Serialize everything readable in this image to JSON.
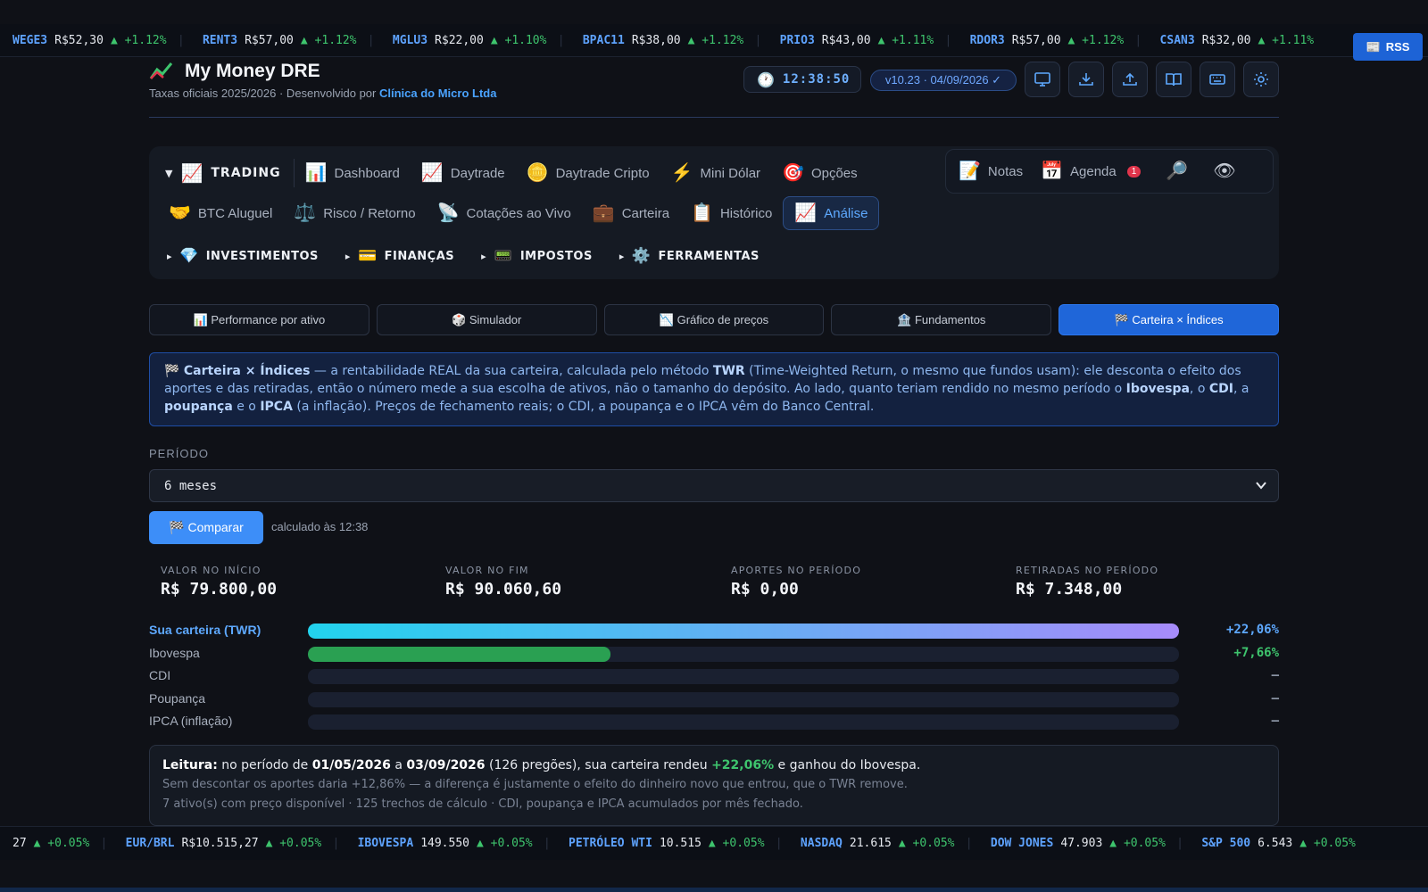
{
  "ticker_top": [
    {
      "symbol": "WEGE3",
      "price": "R$52,30",
      "change": "▲ +1.12%"
    },
    {
      "symbol": "RENT3",
      "price": "R$57,00",
      "change": "▲ +1.12%"
    },
    {
      "symbol": "MGLU3",
      "price": "R$22,00",
      "change": "▲ +1.10%"
    },
    {
      "symbol": "BPAC11",
      "price": "R$38,00",
      "change": "▲ +1.12%"
    },
    {
      "symbol": "PRIO3",
      "price": "R$43,00",
      "change": "▲ +1.11%"
    },
    {
      "symbol": "RDOR3",
      "price": "R$57,00",
      "change": "▲ +1.12%"
    },
    {
      "symbol": "CSAN3",
      "price": "R$32,00",
      "change": "▲ +1.11%"
    }
  ],
  "rss": {
    "label": "RSS",
    "icon": "newspaper-icon"
  },
  "header": {
    "title": "My Money DRE",
    "subtitle_prefix": "Taxas oficiais 2025/2026 · Desenvolvido por ",
    "subtitle_brand": "Clínica do Micro Ltda",
    "clock": "12:38:50",
    "version": "v10.23 · 04/09/2026 ✓",
    "icons": [
      "monitor-icon",
      "download-icon",
      "upload-icon",
      "book-icon",
      "keyboard-icon",
      "settings-icon"
    ]
  },
  "nav": {
    "group_trading": {
      "label": "TRADING",
      "icon": "📈"
    },
    "row1": [
      {
        "label": "Dashboard",
        "icon": "📊"
      },
      {
        "label": "Daytrade",
        "icon": "📈"
      },
      {
        "label": "Daytrade Cripto",
        "icon": "🪙"
      },
      {
        "label": "Mini Dólar",
        "icon": "⚡"
      },
      {
        "label": "Opções",
        "icon": "🎯"
      }
    ],
    "row2": [
      {
        "label": "BTC Aluguel",
        "icon": "🤝"
      },
      {
        "label": "Risco / Retorno",
        "icon": "⚖️"
      },
      {
        "label": "Cotações ao Vivo",
        "icon": "📡"
      },
      {
        "label": "Carteira",
        "icon": "💼"
      },
      {
        "label": "Histórico",
        "icon": "📋"
      },
      {
        "label": "Análise",
        "icon": "📈"
      }
    ],
    "groups": [
      {
        "label": "INVESTIMENTOS",
        "icon": "💎"
      },
      {
        "label": "FINANÇAS",
        "icon": "💳"
      },
      {
        "label": "IMPOSTOS",
        "icon": "📟"
      },
      {
        "label": "FERRAMENTAS",
        "icon": "⚙️"
      }
    ],
    "side": {
      "notes": "Notas",
      "notes_icon": "📝",
      "agenda": "Agenda",
      "agenda_icon": "📅",
      "agenda_badge": "1",
      "search_icon": "🔎",
      "eye_icon": "👁"
    }
  },
  "subtabs": [
    "📊 Performance por ativo",
    "🎲 Simulador",
    "📉 Gráfico de preços",
    "🏦 Fundamentos",
    "🏁 Carteira × Índices"
  ],
  "info": {
    "flag": "🏁",
    "title": "Carteira × Índices",
    "t1": " — a rentabilidade REAL da sua carteira, calculada pelo método ",
    "twr": "TWR",
    "t2": " (Time-Weighted Return, o mesmo que fundos usam): ele desconta o efeito dos aportes e das retiradas, então o número mede a sua escolha de ativos, não o tamanho do depósito. Ao lado, quanto teriam rendido no mesmo período o ",
    "ibov": "Ibovespa",
    "c1": ", o ",
    "cdi": "CDI",
    "c2": ", a ",
    "poup": "poupança",
    "c3": " e o ",
    "ipca": "IPCA",
    "t3": " (a inflação). Preços de fechamento reais; o CDI, a poupança e o IPCA vêm do Banco Central."
  },
  "period": {
    "label": "PERÍODO",
    "value": "6 meses"
  },
  "compare": {
    "label": "🏁 Comparar",
    "calc_at": "calculado às 12:38"
  },
  "stats": [
    {
      "label": "VALOR NO INÍCIO",
      "value": "R$ 79.800,00"
    },
    {
      "label": "VALOR NO FIM",
      "value": "R$ 90.060,60"
    },
    {
      "label": "APORTES NO PERÍODO",
      "value": "R$ 0,00"
    },
    {
      "label": "RETIRADAS NO PERÍODO",
      "value": "R$ 7.348,00"
    }
  ],
  "comparison": [
    {
      "label": "Sua carteira (TWR)",
      "value": "+22,06%",
      "fill": 1.0,
      "color": "#5ea9ff"
    },
    {
      "label": "Ibovespa",
      "value": "+7,66%",
      "fill": 0.347,
      "color": "#3ec46d"
    },
    {
      "label": "CDI",
      "value": "—",
      "fill": 0,
      "color": "#8a93a3"
    },
    {
      "label": "Poupança",
      "value": "—",
      "fill": 0,
      "color": "#8a93a3"
    },
    {
      "label": "IPCA (inflação)",
      "value": "—",
      "fill": 0,
      "color": "#8a93a3"
    }
  ],
  "reading": {
    "lead": "Leitura:",
    "a": " no período de ",
    "start": "01/05/2026",
    "b": " a ",
    "end": "03/09/2026",
    "c": " (126 pregões), sua carteira rendeu ",
    "pct": "+22,06%",
    "d": " e ganhou do Ibovespa.",
    "line2": "Sem descontar os aportes daria +12,86% — a diferença é justamente o efeito do dinheiro novo que entrou, que o TWR remove.",
    "line3": "7 ativo(s) com preço disponível · 125 trechos de cálculo · CDI, poupança e IPCA acumulados por mês fechado."
  },
  "ticker_bottom": [
    {
      "symbol": "",
      "price": "27",
      "change": "▲ +0.05%"
    },
    {
      "symbol": "EUR/BRL",
      "price": "R$10.515,27",
      "change": "▲ +0.05%"
    },
    {
      "symbol": "IBOVESPA",
      "price": "149.550",
      "change": "▲ +0.05%"
    },
    {
      "symbol": "PETRÓLEO WTI",
      "price": "10.515",
      "change": "▲ +0.05%"
    },
    {
      "symbol": "NASDAQ",
      "price": "21.615",
      "change": "▲ +0.05%"
    },
    {
      "symbol": "DOW JONES",
      "price": "47.903",
      "change": "▲ +0.05%"
    },
    {
      "symbol": "S&P 500",
      "price": "6.543",
      "change": "▲ +0.05%"
    }
  ]
}
